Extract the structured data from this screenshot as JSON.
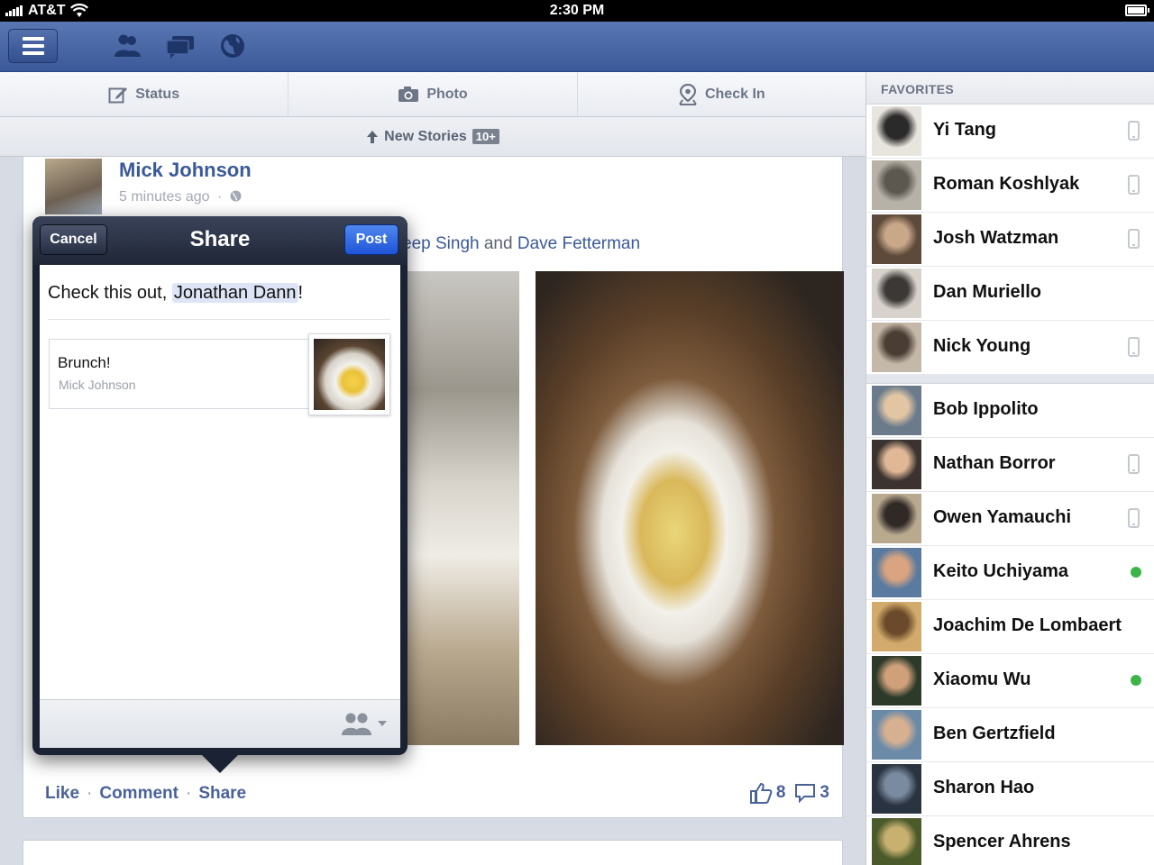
{
  "status_bar": {
    "carrier": "AT&T",
    "time": "2:30 PM"
  },
  "composer": {
    "status": "Status",
    "photo": "Photo",
    "checkin": "Check In"
  },
  "new_stories": {
    "label": "New Stories",
    "count": "10+"
  },
  "post": {
    "author": "Mick Johnson",
    "time": "5 minutes ago",
    "with_prefix": "eep Singh",
    "with_and": "and",
    "with_other": "Dave Fetterman",
    "actions": {
      "like": "Like",
      "comment": "Comment",
      "share": "Share"
    },
    "likes": "8",
    "comments": "3"
  },
  "share_dialog": {
    "title": "Share",
    "cancel": "Cancel",
    "post": "Post",
    "message_prefix": "Check this out,",
    "mention": "Jonathan Dann",
    "message_suffix": "!",
    "attachment_title": "Brunch!",
    "attachment_author": "Mick Johnson"
  },
  "sidebar": {
    "header": "FAVORITES",
    "favorites": [
      {
        "name": "Yi Tang",
        "status": "mobile"
      },
      {
        "name": "Roman Koshlyak",
        "status": "mobile"
      },
      {
        "name": "Josh Watzman",
        "status": "mobile"
      },
      {
        "name": "Dan Muriello",
        "status": "none"
      },
      {
        "name": "Nick Young",
        "status": "mobile"
      }
    ],
    "contacts": [
      {
        "name": "Bob Ippolito",
        "status": "none"
      },
      {
        "name": "Nathan Borror",
        "status": "mobile"
      },
      {
        "name": "Owen Yamauchi",
        "status": "mobile"
      },
      {
        "name": "Keito Uchiyama",
        "status": "online"
      },
      {
        "name": "Joachim De Lombaert",
        "status": "none"
      },
      {
        "name": "Xiaomu Wu",
        "status": "online"
      },
      {
        "name": "Ben Gertzfield",
        "status": "none"
      },
      {
        "name": "Sharon Hao",
        "status": "none"
      },
      {
        "name": "Spencer Ahrens",
        "status": "none"
      }
    ]
  },
  "colors": {
    "brand": "#3b5998",
    "online": "#3bb44a"
  }
}
